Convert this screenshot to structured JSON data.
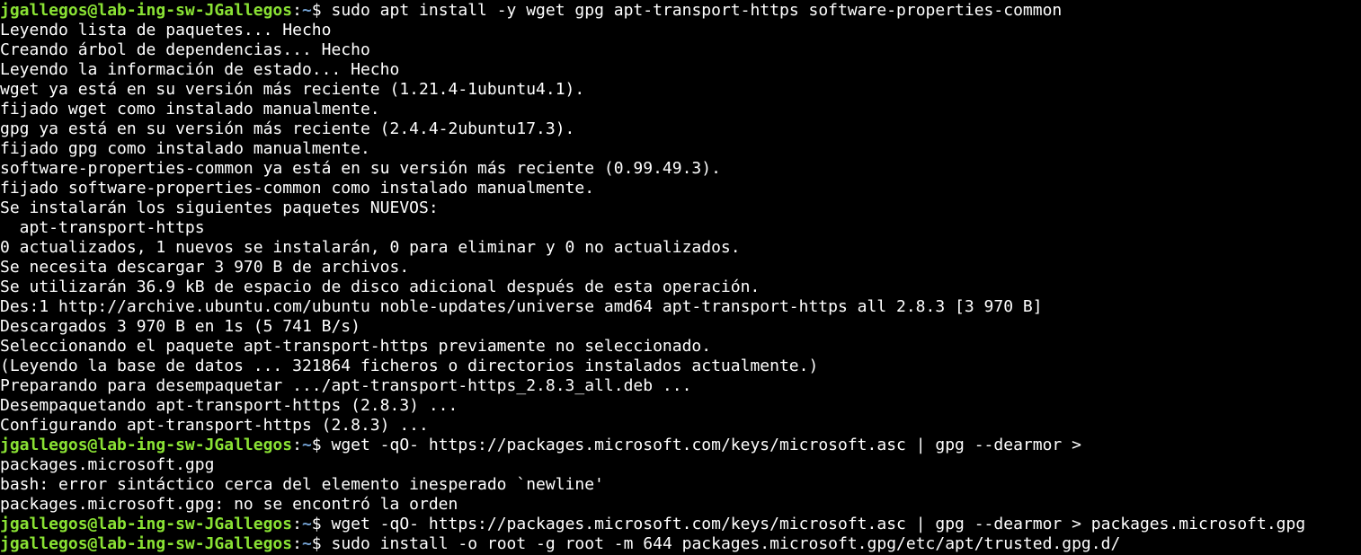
{
  "terminal": {
    "colors": {
      "background": "#000000",
      "text": "#ffffff",
      "prompt_user": "#8ae234",
      "prompt_path": "#729fcf"
    },
    "prompt": {
      "user_host": "jgallegos@lab-ing-sw-JGallegos",
      "separator": ":",
      "path": "~",
      "symbol": "$ "
    },
    "lines": [
      {
        "type": "command",
        "text": "sudo apt install -y wget gpg apt-transport-https software-properties-common"
      },
      {
        "type": "output",
        "text": "Leyendo lista de paquetes... Hecho"
      },
      {
        "type": "output",
        "text": "Creando árbol de dependencias... Hecho"
      },
      {
        "type": "output",
        "text": "Leyendo la información de estado... Hecho"
      },
      {
        "type": "output",
        "text": "wget ya está en su versión más reciente (1.21.4-1ubuntu4.1)."
      },
      {
        "type": "output",
        "text": "fijado wget como instalado manualmente."
      },
      {
        "type": "output",
        "text": "gpg ya está en su versión más reciente (2.4.4-2ubuntu17.3)."
      },
      {
        "type": "output",
        "text": "fijado gpg como instalado manualmente."
      },
      {
        "type": "output",
        "text": "software-properties-common ya está en su versión más reciente (0.99.49.3)."
      },
      {
        "type": "output",
        "text": "fijado software-properties-common como instalado manualmente."
      },
      {
        "type": "output",
        "text": "Se instalarán los siguientes paquetes NUEVOS:"
      },
      {
        "type": "output",
        "text": "  apt-transport-https"
      },
      {
        "type": "output",
        "text": "0 actualizados, 1 nuevos se instalarán, 0 para eliminar y 0 no actualizados."
      },
      {
        "type": "output",
        "text": "Se necesita descargar 3 970 B de archivos."
      },
      {
        "type": "output",
        "text": "Se utilizarán 36.9 kB de espacio de disco adicional después de esta operación."
      },
      {
        "type": "output",
        "text": "Des:1 http://archive.ubuntu.com/ubuntu noble-updates/universe amd64 apt-transport-https all 2.8.3 [3 970 B]"
      },
      {
        "type": "output",
        "text": "Descargados 3 970 B en 1s (5 741 B/s)"
      },
      {
        "type": "output",
        "text": "Seleccionando el paquete apt-transport-https previamente no seleccionado."
      },
      {
        "type": "output",
        "text": "(Leyendo la base de datos ... 321864 ficheros o directorios instalados actualmente.)"
      },
      {
        "type": "output",
        "text": "Preparando para desempaquetar .../apt-transport-https_2.8.3_all.deb ..."
      },
      {
        "type": "output",
        "text": "Desempaquetando apt-transport-https (2.8.3) ..."
      },
      {
        "type": "output",
        "text": "Configurando apt-transport-https (2.8.3) ..."
      },
      {
        "type": "command",
        "text": "wget -qO- https://packages.microsoft.com/keys/microsoft.asc | gpg --dearmor >"
      },
      {
        "type": "output",
        "text": "packages.microsoft.gpg"
      },
      {
        "type": "output",
        "text": "bash: error sintáctico cerca del elemento inesperado `newline'"
      },
      {
        "type": "output",
        "text": "packages.microsoft.gpg: no se encontró la orden"
      },
      {
        "type": "command",
        "text": "wget -qO- https://packages.microsoft.com/keys/microsoft.asc | gpg --dearmor > packages.microsoft.gpg"
      },
      {
        "type": "command",
        "text": "sudo install -o root -g root -m 644 packages.microsoft.gpg/etc/apt/trusted.gpg.d/"
      }
    ]
  }
}
